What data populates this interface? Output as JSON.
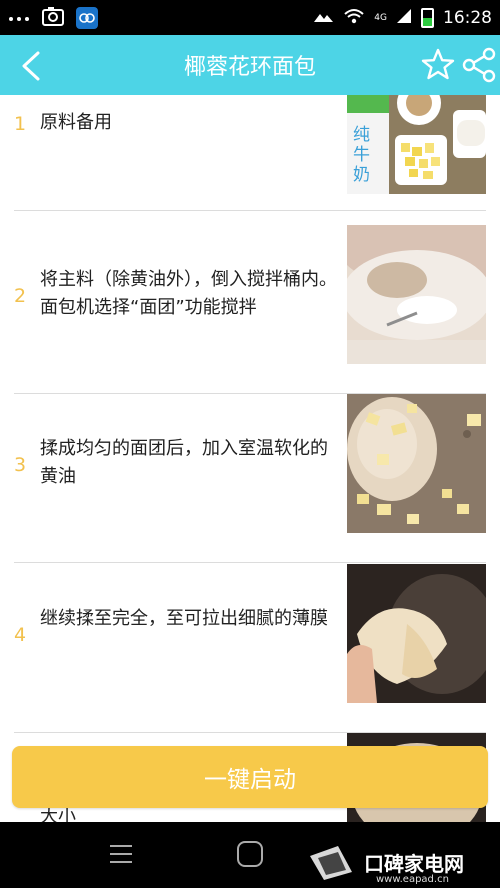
{
  "status_bar": {
    "network_label": "4G",
    "time": "16:28",
    "battery_level": 0.45,
    "icons": [
      "dots-icon",
      "screenshot-icon",
      "app-icon",
      "cloud-icon",
      "wifi-icon",
      "signal-icon",
      "battery-icon"
    ]
  },
  "header": {
    "title": "椰蓉花环面包",
    "accent_color": "#4dd4e6"
  },
  "steps": [
    {
      "number": "1",
      "text": "原料备用",
      "photo_icon": "ingredients-photo"
    },
    {
      "number": "2",
      "text": "将主料（除黄油外），倒入搅拌桶内。面包机选择“面团”功能搅拌",
      "photo_icon": "flour-mixing-photo"
    },
    {
      "number": "3",
      "text": "揉成均匀的面团后，加入室温软化的黄油",
      "photo_icon": "butter-dough-photo"
    },
    {
      "number": "4",
      "text": "继续揉至完全，至可拉出细腻的薄膜",
      "photo_icon": "dough-membrane-photo"
    },
    {
      "number": "",
      "text": "大小",
      "photo_icon": "dough-risen-photo"
    }
  ],
  "start_button": {
    "label": "一键启动",
    "color": "#f7c94a"
  },
  "watermark": {
    "title": "口碑家电网",
    "url": "www.eapad.cn"
  }
}
